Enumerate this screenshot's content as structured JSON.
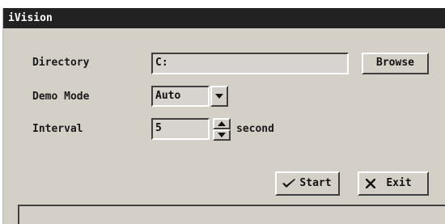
{
  "window": {
    "title": "iVision"
  },
  "form": {
    "directory": {
      "label": "Directory",
      "value": "C:",
      "browse_label": "Browse"
    },
    "demo_mode": {
      "label": "Demo Mode",
      "value": "Auto"
    },
    "interval": {
      "label": "Interval",
      "value": "5",
      "unit": "second"
    }
  },
  "actions": {
    "start_label": "Start",
    "start_icon": "checkmark-icon",
    "exit_label": "Exit",
    "exit_icon": "x-icon"
  },
  "colors": {
    "titlebar": "#222222",
    "window_bg": "#d4d0c8",
    "field_bg": "#d7d4ce"
  }
}
